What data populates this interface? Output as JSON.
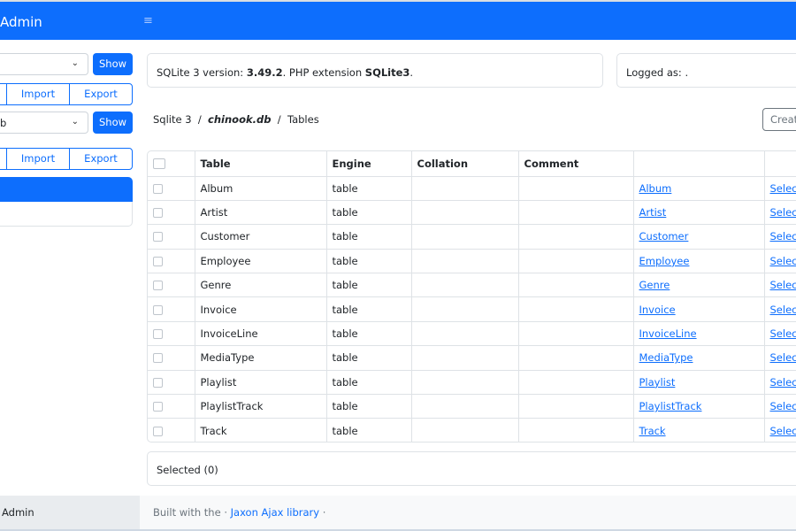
{
  "app": {
    "brand": "Admin",
    "menu_icon": "hamburger-icon"
  },
  "sidebar": {
    "server_select": {
      "value": ""
    },
    "show_label": "Show",
    "import_label": "Import",
    "export_label": "Export",
    "db_select": {
      "value": "b"
    },
    "show_label_2": "Show",
    "import_label_2": "Import",
    "export_label_2": "Export"
  },
  "info": {
    "prefix": "SQLite 3 version: ",
    "version": "3.49.2",
    "mid": ". PHP extension ",
    "ext": "SQLite3",
    "suffix": ".",
    "logged": "Logged as: ."
  },
  "breadcrumb": {
    "driver": "Sqlite 3",
    "sep1": "/",
    "db": "chinook.db",
    "sep2": "/",
    "page": "Tables"
  },
  "create_label": "Create",
  "table": {
    "headers": [
      "",
      "Table",
      "Engine",
      "Collation",
      "Comment",
      "",
      ""
    ],
    "rows": [
      {
        "name": "Album",
        "engine": "table",
        "link": "Album",
        "action": "Select"
      },
      {
        "name": "Artist",
        "engine": "table",
        "link": "Artist",
        "action": "Select"
      },
      {
        "name": "Customer",
        "engine": "table",
        "link": "Customer",
        "action": "Select"
      },
      {
        "name": "Employee",
        "engine": "table",
        "link": "Employee",
        "action": "Select"
      },
      {
        "name": "Genre",
        "engine": "table",
        "link": "Genre",
        "action": "Select"
      },
      {
        "name": "Invoice",
        "engine": "table",
        "link": "Invoice",
        "action": "Select"
      },
      {
        "name": "InvoiceLine",
        "engine": "table",
        "link": "InvoiceLine",
        "action": "Select"
      },
      {
        "name": "MediaType",
        "engine": "table",
        "link": "MediaType",
        "action": "Select"
      },
      {
        "name": "Playlist",
        "engine": "table",
        "link": "Playlist",
        "action": "Select"
      },
      {
        "name": "PlaylistTrack",
        "engine": "table",
        "link": "PlaylistTrack",
        "action": "Select"
      },
      {
        "name": "Track",
        "engine": "table",
        "link": "Track",
        "action": "Select"
      }
    ]
  },
  "selected_label": "Selected (0)",
  "footer": {
    "left": "Admin",
    "built_prefix": "Built with the · ",
    "link": "Jaxon Ajax library",
    "built_suffix": " ·"
  },
  "colors": {
    "primary": "#0d6efd",
    "border": "#dee2e6",
    "footer_bg": "#f8f9fa"
  }
}
